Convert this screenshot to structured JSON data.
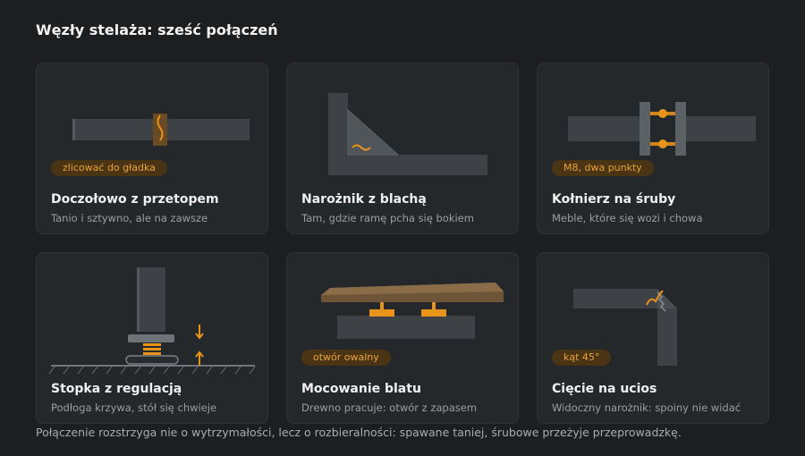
{
  "title": "Węzły stelaża: sześć połączeń",
  "cards": [
    {
      "title": "Doczołowo z przetopem",
      "subtitle": "Tanio i sztywno, ale na zawsze",
      "badge": "zlicować do gładka"
    },
    {
      "title": "Narożnik z blachą",
      "subtitle": "Tam, gdzie ramę pcha się bokiem",
      "badge": ""
    },
    {
      "title": "Kołnierz na śruby",
      "subtitle": "Meble, które się wozi i chowa",
      "badge": "M8, dwa punkty"
    },
    {
      "title": "Stopka z regulacją",
      "subtitle": "Podłoga krzywa, stół się chwieje",
      "badge": ""
    },
    {
      "title": "Mocowanie blatu",
      "subtitle": "Drewno pracuje: otwór z zapasem",
      "badge": "otwór owalny"
    },
    {
      "title": "Cięcie na ucios",
      "subtitle": "Widoczny narożnik: spoiny nie widać",
      "badge": "kąt 45°"
    }
  ],
  "footer": "Połączenie rozstrzyga nie o wytrzymałości, lecz o rozbieralności: spawane taniej, śrubowe przeżyje przeprowadzkę.",
  "colors": {
    "background": "#1c1e20",
    "card": "#25282b",
    "steel": "#3e4247",
    "accent": "#e8941a",
    "wood": "#6e5538"
  }
}
